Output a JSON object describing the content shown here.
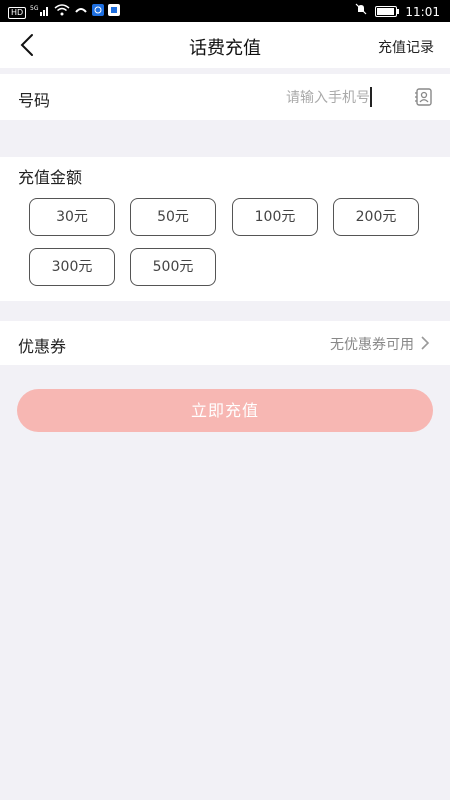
{
  "status_bar": {
    "hd": "HD",
    "signal": "5G",
    "time": "11:01",
    "battery_level": 0.9
  },
  "nav": {
    "title": "话费充值",
    "action": "充值记录"
  },
  "phone": {
    "label": "号码",
    "placeholder": "请输入手机号",
    "value": ""
  },
  "amount": {
    "title": "充值金额",
    "options": [
      "30元",
      "50元",
      "100元",
      "200元",
      "300元",
      "500元"
    ]
  },
  "coupon": {
    "label": "优惠券",
    "value": "无优惠券可用"
  },
  "submit": {
    "label": "立即充值",
    "color": "#f7b7b3"
  },
  "icons": {
    "back": "back-arrow-icon",
    "contacts": "contacts-icon",
    "chevron": "chevron-right-icon"
  }
}
